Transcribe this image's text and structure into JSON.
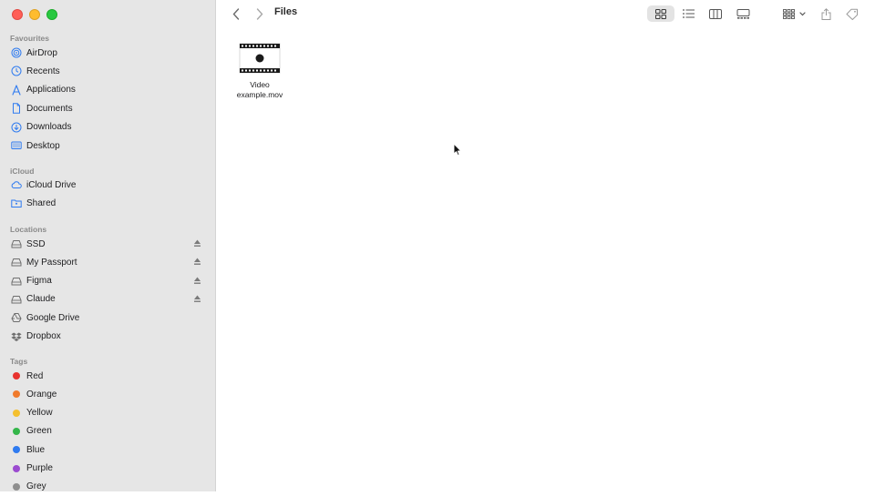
{
  "window": {
    "title": "Files"
  },
  "sidebar": {
    "favourites_header": "Favourites",
    "favourites": [
      {
        "label": "AirDrop",
        "icon": "airdrop-icon"
      },
      {
        "label": "Recents",
        "icon": "clock-icon"
      },
      {
        "label": "Applications",
        "icon": "applications-icon"
      },
      {
        "label": "Documents",
        "icon": "document-icon"
      },
      {
        "label": "Downloads",
        "icon": "download-icon"
      },
      {
        "label": "Desktop",
        "icon": "desktop-icon"
      }
    ],
    "icloud_header": "iCloud",
    "icloud": [
      {
        "label": "iCloud Drive",
        "icon": "cloud-icon"
      },
      {
        "label": "Shared",
        "icon": "shared-folder-icon"
      }
    ],
    "locations_header": "Locations",
    "locations": [
      {
        "label": "SSD",
        "icon": "drive-icon",
        "eject": true
      },
      {
        "label": "My Passport",
        "icon": "drive-icon",
        "eject": true
      },
      {
        "label": "Figma",
        "icon": "drive-icon",
        "eject": true
      },
      {
        "label": "Claude",
        "icon": "drive-icon",
        "eject": true
      },
      {
        "label": "Google Drive",
        "icon": "google-drive-icon",
        "eject": false
      },
      {
        "label": "Dropbox",
        "icon": "dropbox-icon",
        "eject": false
      }
    ],
    "tags_header": "Tags",
    "tags": [
      {
        "label": "Red",
        "color": "#e8322e"
      },
      {
        "label": "Orange",
        "color": "#f07a2c"
      },
      {
        "label": "Yellow",
        "color": "#f4c02f"
      },
      {
        "label": "Green",
        "color": "#34b64a"
      },
      {
        "label": "Blue",
        "color": "#2f7bf0"
      },
      {
        "label": "Purple",
        "color": "#9b4bd0"
      },
      {
        "label": "Grey",
        "color": "#8e8e8e"
      }
    ]
  },
  "toolbar": {
    "icons": [
      "back-icon",
      "forward-icon",
      "icon-view-icon",
      "list-view-icon",
      "column-view-icon",
      "gallery-view-icon",
      "group-icon",
      "share-icon",
      "tag-icon"
    ]
  },
  "files": [
    {
      "name_line1": "Video",
      "name_line2": "example.mov"
    }
  ],
  "colors": {
    "accent": "#2f7bf0",
    "sidebar_bg": "#e6e6e6"
  }
}
